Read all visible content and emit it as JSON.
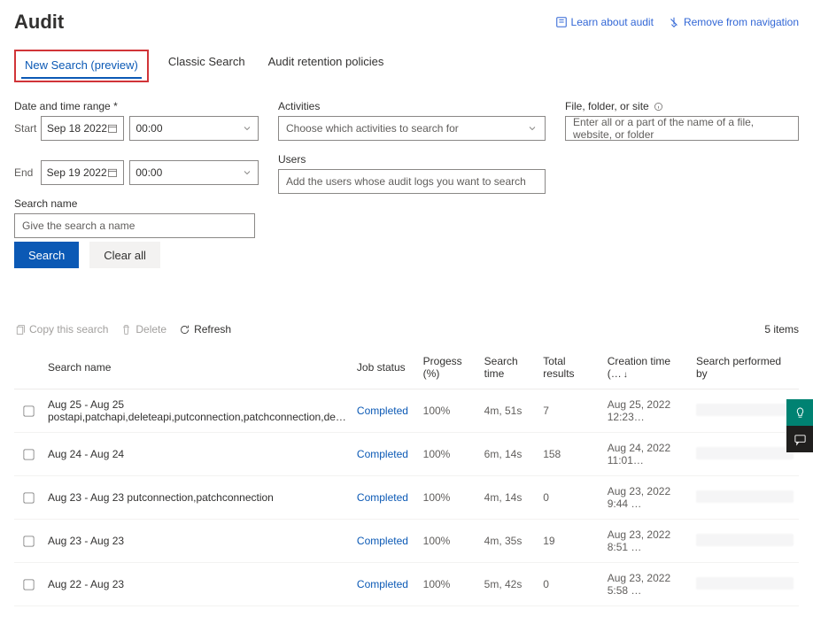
{
  "header": {
    "title": "Audit",
    "learn_link": "Learn about audit",
    "remove_link": "Remove from navigation"
  },
  "tabs": {
    "new_search": "New Search (preview)",
    "classic": "Classic Search",
    "retention": "Audit retention policies"
  },
  "form": {
    "range_label": "Date and time range *",
    "start_label": "Start",
    "end_label": "End",
    "start_date": "Sep 18 2022",
    "start_time": "00:00",
    "end_date": "Sep 19 2022",
    "end_time": "00:00",
    "activities_label": "Activities",
    "activities_placeholder": "Choose which activities to search for",
    "users_label": "Users",
    "users_placeholder": "Add the users whose audit logs you want to search",
    "file_label": "File, folder, or site",
    "file_placeholder": "Enter all or a part of the name of a file, website, or folder",
    "search_name_label": "Search name",
    "search_name_placeholder": "Give the search a name",
    "search_btn": "Search",
    "clear_btn": "Clear all"
  },
  "toolbar": {
    "copy": "Copy this search",
    "delete": "Delete",
    "refresh": "Refresh",
    "count": "5 items"
  },
  "table": {
    "headers": {
      "name": "Search name",
      "status": "Job status",
      "progress": "Progess (%)",
      "searchtime": "Search time",
      "results": "Total results",
      "creation": "Creation time (…",
      "performer": "Search performed by"
    },
    "rows": [
      {
        "name": "Aug 25 - Aug 25 postapi,patchapi,deleteapi,putconnection,patchconnection,de…",
        "status": "Completed",
        "progress": "100%",
        "searchtime": "4m, 51s",
        "results": "7",
        "creation": "Aug 25, 2022 12:23…"
      },
      {
        "name": "Aug 24 - Aug 24",
        "status": "Completed",
        "progress": "100%",
        "searchtime": "6m, 14s",
        "results": "158",
        "creation": "Aug 24, 2022 11:01…"
      },
      {
        "name": "Aug 23 - Aug 23 putconnection,patchconnection",
        "status": "Completed",
        "progress": "100%",
        "searchtime": "4m, 14s",
        "results": "0",
        "creation": "Aug 23, 2022 9:44 …"
      },
      {
        "name": "Aug 23 - Aug 23",
        "status": "Completed",
        "progress": "100%",
        "searchtime": "4m, 35s",
        "results": "19",
        "creation": "Aug 23, 2022 8:51 …"
      },
      {
        "name": "Aug 22 - Aug 23",
        "status": "Completed",
        "progress": "100%",
        "searchtime": "5m, 42s",
        "results": "0",
        "creation": "Aug 23, 2022 5:58 …"
      }
    ]
  }
}
